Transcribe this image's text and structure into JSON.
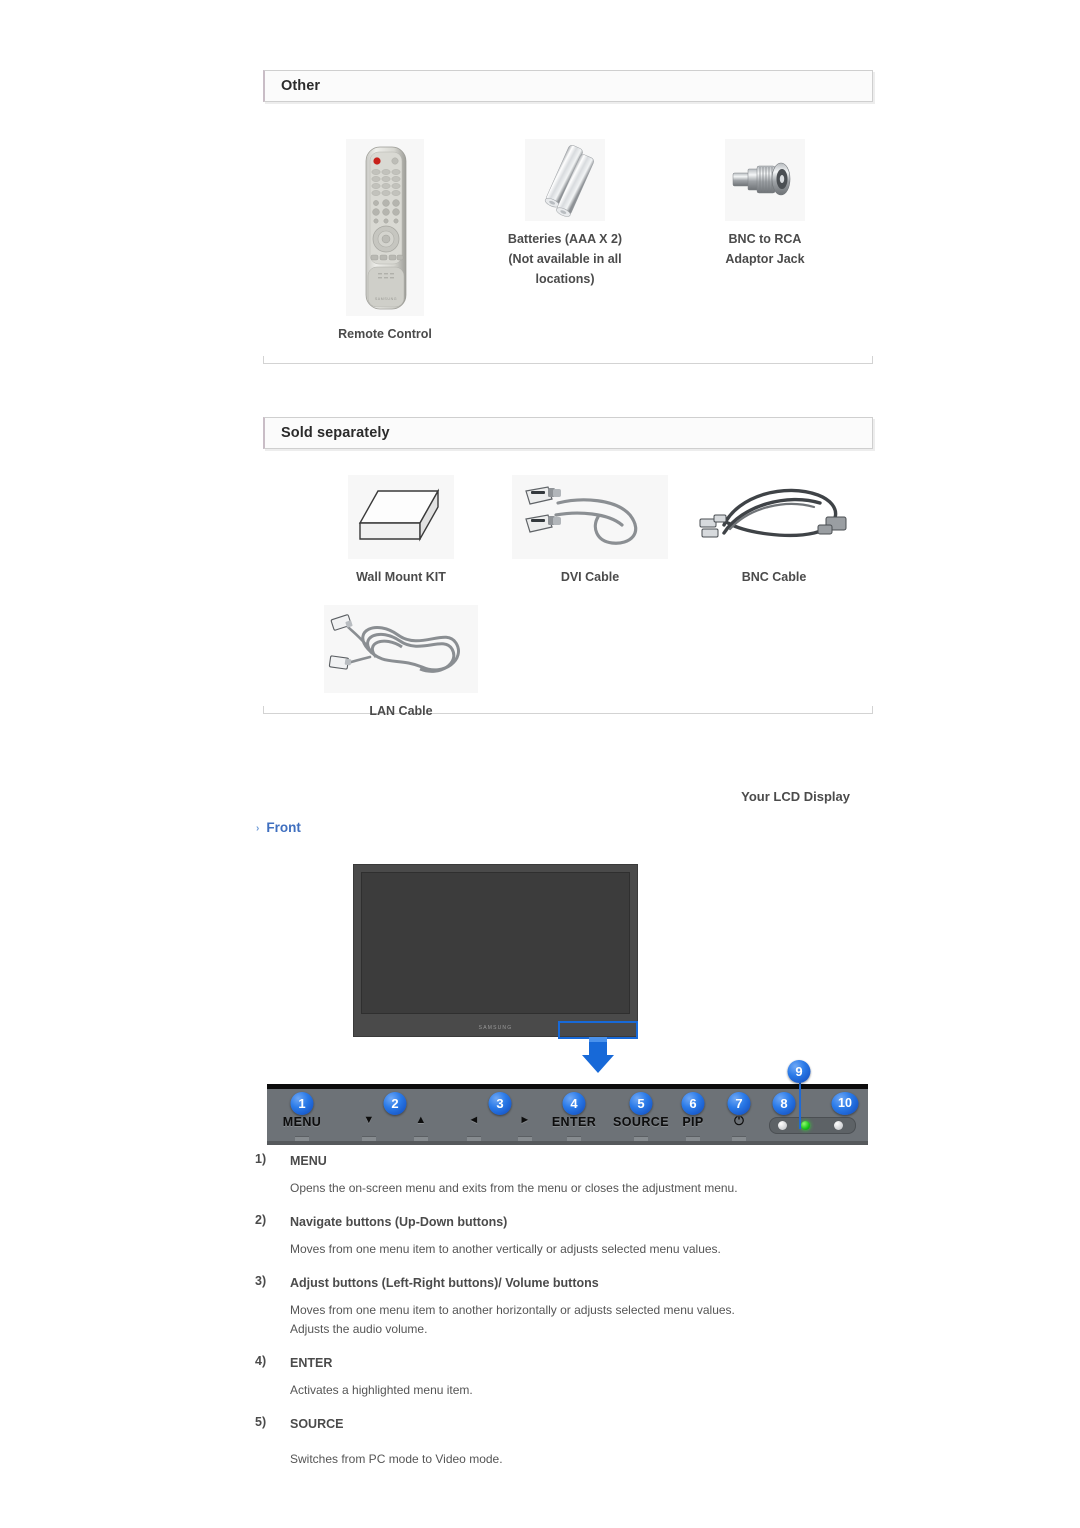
{
  "sections": [
    {
      "id": "other",
      "title": "Other",
      "items": [
        {
          "label": "Remote Control",
          "icon": "remote-control-image"
        },
        {
          "label": "Batteries (AAA X 2)\n(Not available in all\nlocations)",
          "icon": "batteries-image"
        },
        {
          "label": "BNC to RCA\nAdaptor Jack",
          "icon": "bnc-to-rca-adaptor-image"
        }
      ]
    },
    {
      "id": "sold-separately",
      "title": "Sold separately",
      "items": [
        {
          "label": "Wall Mount KIT",
          "icon": "wall-mount-kit-image"
        },
        {
          "label": "DVI Cable",
          "icon": "dvi-cable-image"
        },
        {
          "label": "BNC Cable",
          "icon": "bnc-cable-image"
        },
        {
          "label": "LAN Cable",
          "icon": "lan-cable-image"
        }
      ]
    }
  ],
  "lcd": {
    "heading": "Your LCD Display",
    "front_label": "Front",
    "chevron": "›",
    "monitor_brand": "SAMSUNG"
  },
  "control_panel": {
    "buttons": [
      {
        "n": "1",
        "label": "MENU"
      },
      {
        "n": "2",
        "label": "▼"
      },
      {
        "n": "2b",
        "label": "▲"
      },
      {
        "n": "3",
        "label": "◄"
      },
      {
        "n": "3b",
        "label": "►"
      },
      {
        "n": "4",
        "label": "ENTER"
      },
      {
        "n": "5",
        "label": "SOURCE"
      },
      {
        "n": "6",
        "label": "PIP"
      },
      {
        "n": "7",
        "label": "⏻"
      }
    ],
    "badges": [
      "1",
      "2",
      "3",
      "4",
      "5",
      "6",
      "7",
      "8",
      "9",
      "10"
    ]
  },
  "descriptions": [
    {
      "num": "1)",
      "title": "MENU",
      "lines": [
        "Opens the on-screen menu and exits from the menu or closes the adjustment menu."
      ]
    },
    {
      "num": "2)",
      "title": "Navigate buttons (Up-Down buttons)",
      "lines": [
        "Moves from one menu item to another vertically or adjusts selected menu values."
      ]
    },
    {
      "num": "3)",
      "title": "Adjust buttons (Left-Right buttons)/ Volume buttons",
      "lines": [
        "Moves from one menu item to another horizontally or adjusts selected menu values.",
        "Adjusts the audio volume."
      ]
    },
    {
      "num": "4)",
      "title": "ENTER",
      "lines": [
        "Activates a highlighted menu item."
      ]
    },
    {
      "num": "5)",
      "title": "SOURCE",
      "lines": [
        "Switches from PC mode to Video mode."
      ]
    }
  ],
  "colors": {
    "accent_blue": "#2a7ae8",
    "link_blue": "#3f6fbf",
    "led_green": "#17c417",
    "panel_gray": "#6d7277"
  }
}
